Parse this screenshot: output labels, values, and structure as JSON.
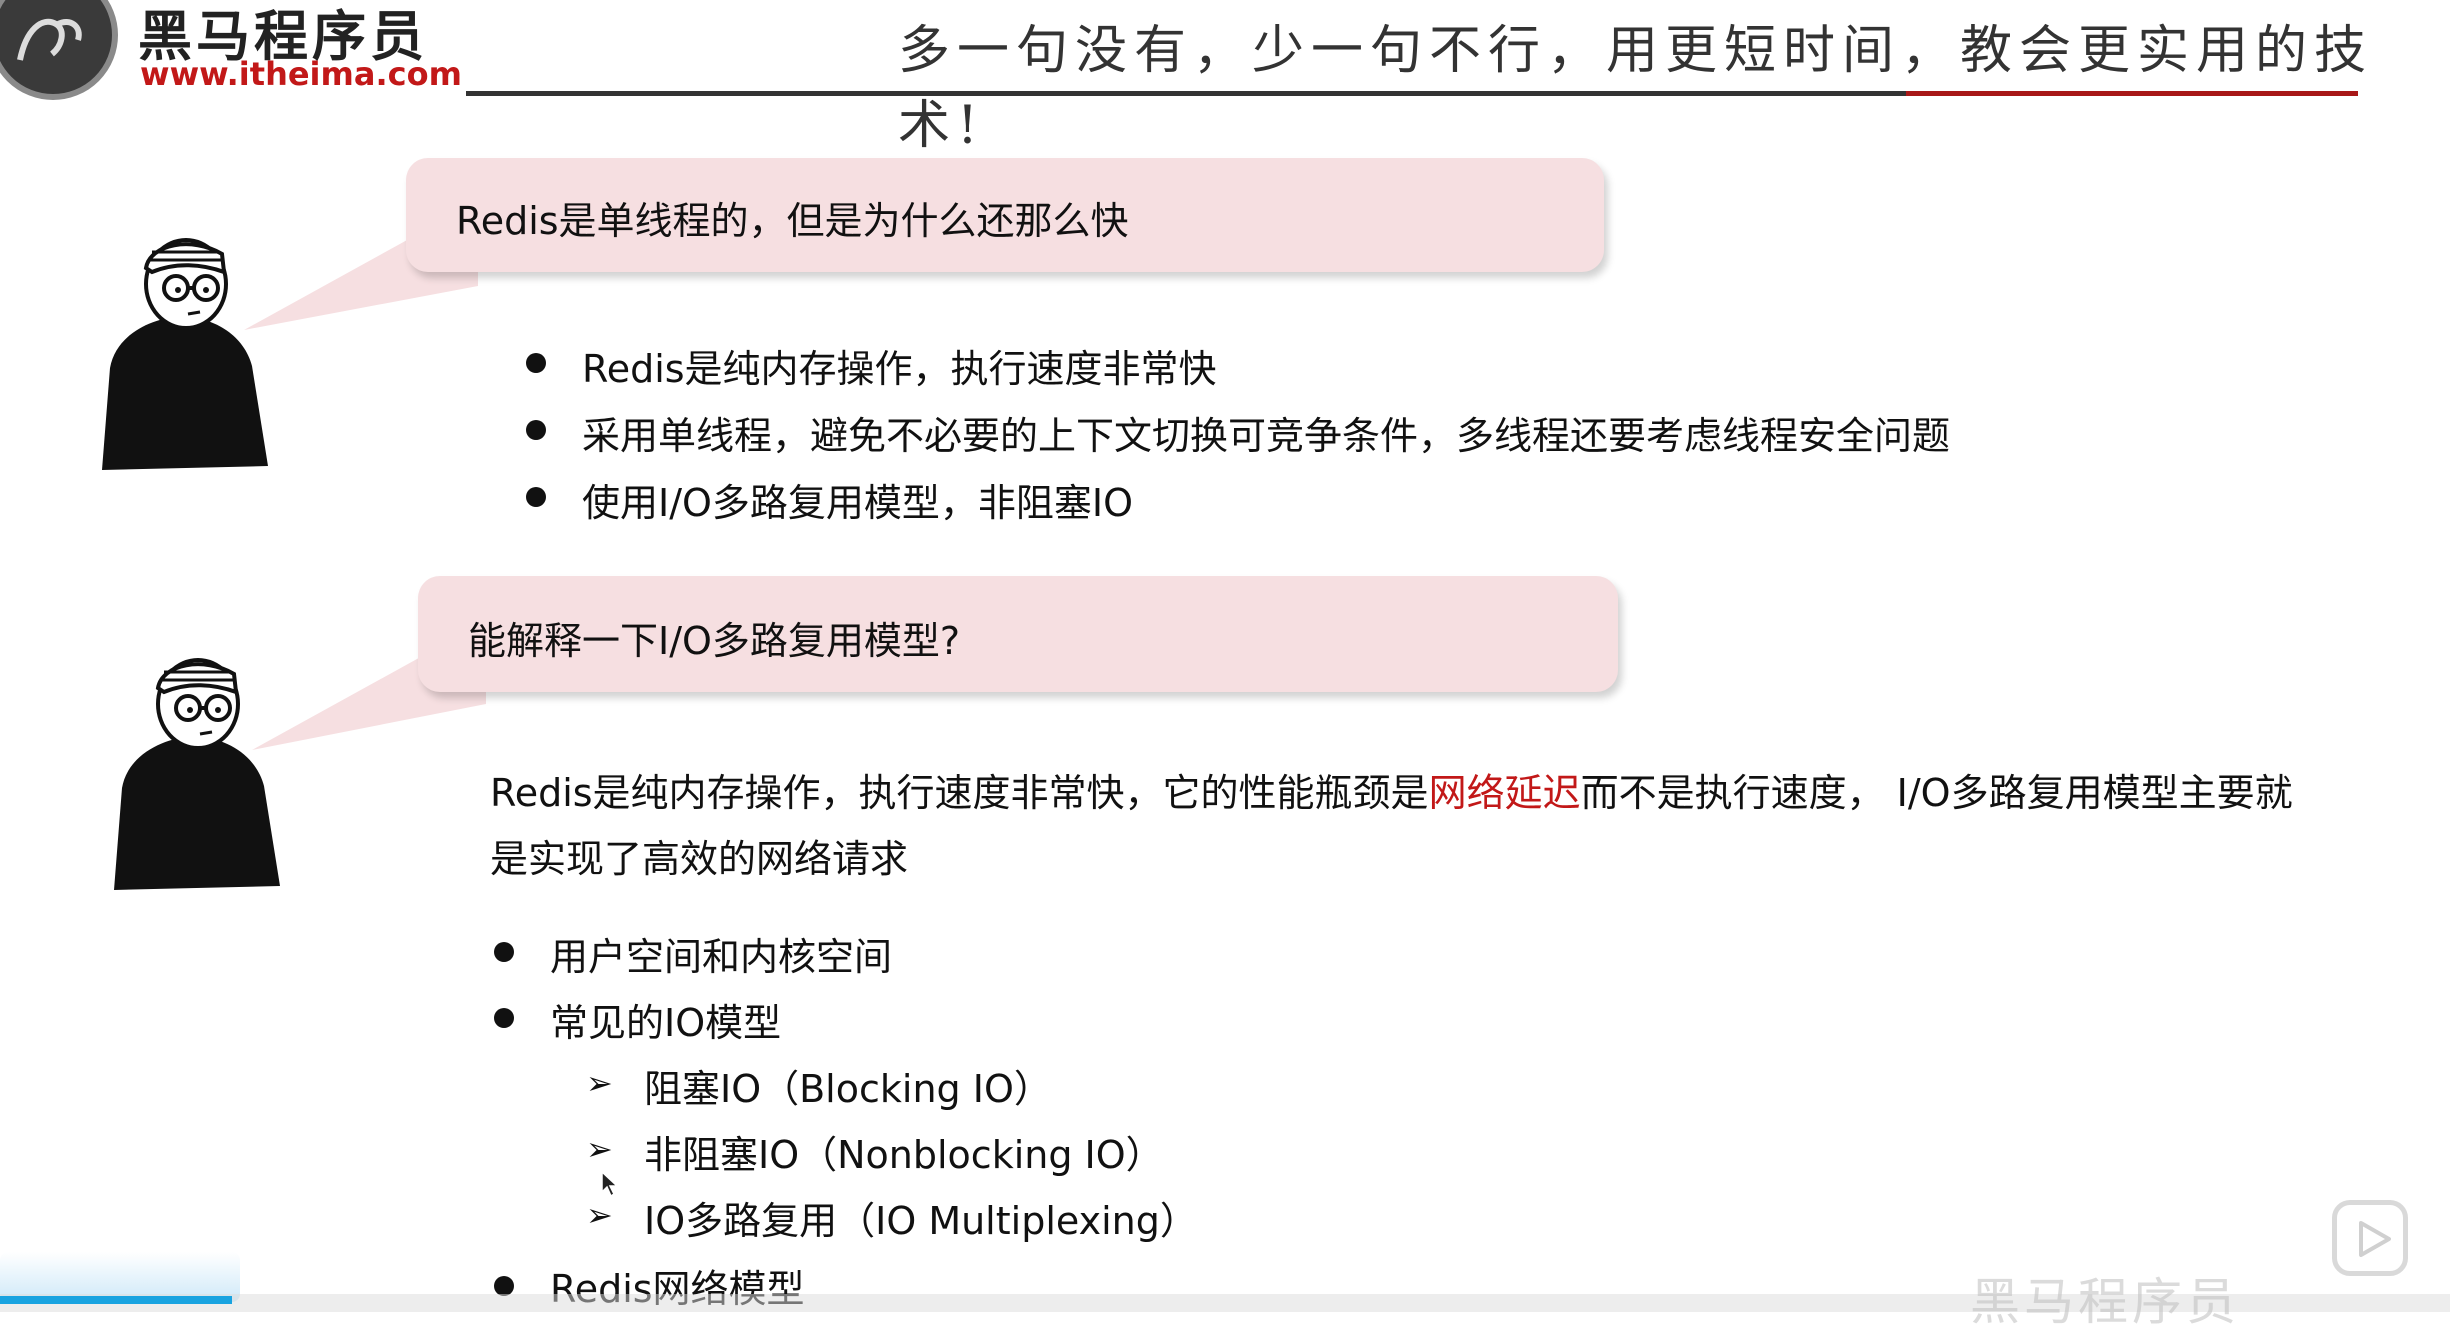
{
  "header": {
    "brand_cn": "黑马程序员",
    "brand_url": "www.itheima.com",
    "slogan": "多一句没有，少一句不行，用更短时间，教会更实用的技术!"
  },
  "section1": {
    "question": "Redis是单线程的，但是为什么还那么快",
    "bullets": [
      "Redis是纯内存操作，执行速度非常快",
      "采用单线程，避免不必要的上下文切换可竞争条件，多线程还要考虑线程安全问题",
      "使用I/O多路复用模型，非阻塞IO"
    ]
  },
  "section2": {
    "question": "能解释一下I/O多路复用模型?",
    "para_line1_a": "Redis是纯内存操作，执行速度非常快，它的性能瓶颈是",
    "para_line1_highlight": "网络延迟",
    "para_line1_b": "而不是执行速度， I/O多路复用模型主要就",
    "para_line2": "是实现了高效的网络请求",
    "bullets": [
      "用户空间和内核空间",
      "常见的IO模型",
      "Redis网络模型"
    ],
    "sub_items": [
      "阻塞IO（Blocking IO）",
      "非阻塞IO（Nonblocking IO）",
      "IO多路复用（IO Multiplexing）"
    ]
  },
  "overlay": {
    "watermark": "黑马程序员"
  },
  "colors": {
    "bubble": "#f6dfe1",
    "highlight": "#c21818",
    "accent_rule": "#a81818",
    "progress": "#19a3e0"
  }
}
